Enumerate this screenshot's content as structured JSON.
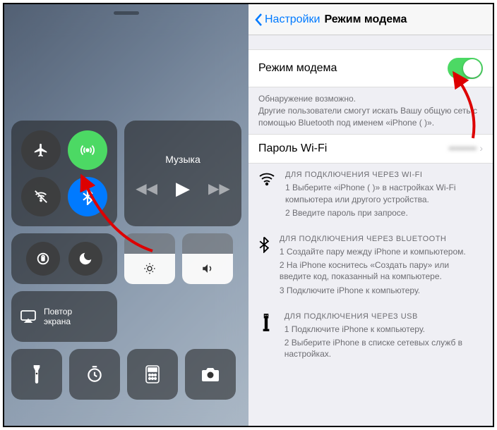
{
  "controlCenter": {
    "musicTitle": "Музыка",
    "mirrorTitle": "Повтор\nэкрана"
  },
  "settings": {
    "back": "Настройки",
    "title": "Режим модема",
    "toggle": {
      "label": "Режим модема"
    },
    "discoverLine1": "Обнаружение возможно.",
    "discoverLine2": "Другие пользователи смогут искать Вашу общую сеть с помощью Bluetooth под именем «iPhone (              )».",
    "wifiPassword": {
      "label": "Пароль Wi-Fi"
    },
    "wifi": {
      "title": "ДЛЯ ПОДКЛЮЧЕНИЯ ЧЕРЕЗ WI-FI",
      "step1": "1 Выберите «iPhone (               )» в настройках Wi-Fi компьютера или другого устройства.",
      "step2": "2 Введите пароль при запросе."
    },
    "bt": {
      "title": "ДЛЯ ПОДКЛЮЧЕНИЯ ЧЕРЕЗ BLUETOOTH",
      "step1": "1 Создайте пару между iPhone и компьютером.",
      "step2": "2 На iPhone коснитесь «Создать пару» или введите код, показанный на компьютере.",
      "step3": "3 Подключите iPhone к компьютеру."
    },
    "usb": {
      "title": "ДЛЯ ПОДКЛЮЧЕНИЯ ЧЕРЕЗ USB",
      "step1": "1 Подключите iPhone к компьютеру.",
      "step2": "2 Выберите iPhone в списке сетевых служб в настройках."
    }
  }
}
